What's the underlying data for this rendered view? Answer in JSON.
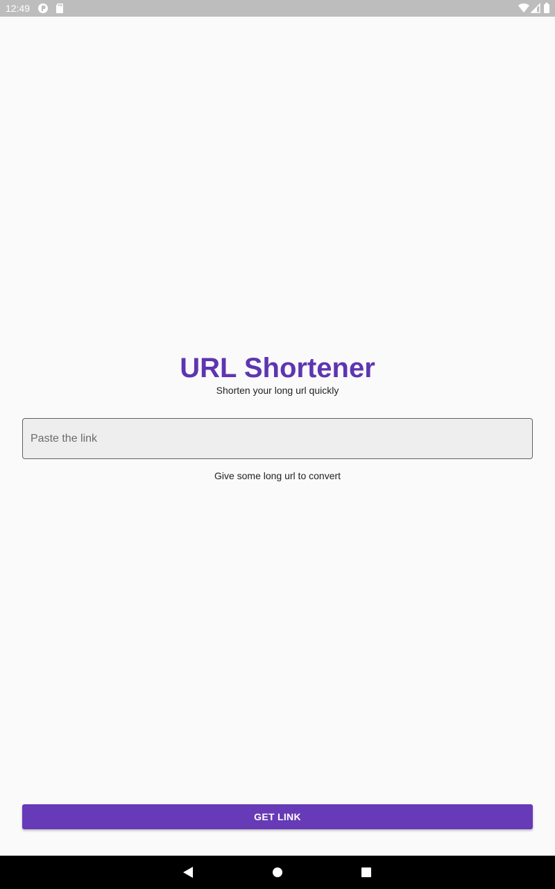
{
  "status_bar": {
    "time": "12:49",
    "left_icons": [
      "sync-icon",
      "sd-card-icon"
    ],
    "right_icons": [
      "wifi-icon",
      "signal-icon",
      "battery-icon"
    ]
  },
  "main": {
    "title": "URL Shortener",
    "subtitle": "Shorten your long url quickly",
    "link_input": {
      "value": "",
      "placeholder": "Paste the link"
    },
    "helper_text": "Give some long url to convert",
    "get_link_label": "GET LINK"
  },
  "nav_bar": {
    "buttons": [
      "back-icon",
      "home-icon",
      "recents-icon"
    ]
  },
  "colors": {
    "accent": "#673ab7",
    "title": "#5e35b1",
    "status_bar": "#bdbdbd",
    "nav_bar": "#000000",
    "background": "#fafafa"
  }
}
